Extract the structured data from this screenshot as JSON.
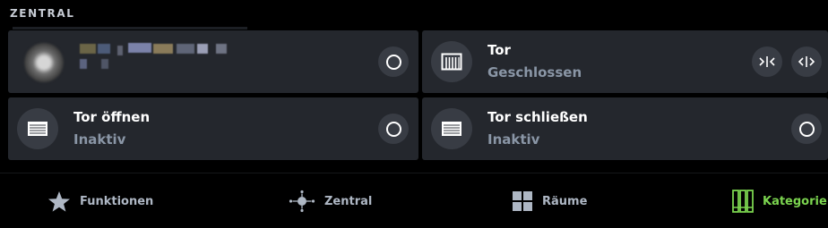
{
  "section": {
    "title": "ZENTRAL"
  },
  "cards": [
    {
      "title": "",
      "status": ""
    },
    {
      "title": "Tor",
      "status": "Geschlossen"
    },
    {
      "title": "Tor öffnen",
      "status": "Inaktiv"
    },
    {
      "title": "Tor schließen",
      "status": "Inaktiv"
    }
  ],
  "icons": {
    "toggle": "circle-toggle-icon",
    "gate": "garage-gate-icon",
    "close_gate": "arrows-inward-icon",
    "open_gate": "arrows-outward-icon",
    "blinds": "blinds-icon"
  },
  "nav": {
    "items": [
      {
        "label": "Funktionen",
        "icon": "star-icon"
      },
      {
        "label": "Zentral",
        "icon": "hub-icon"
      },
      {
        "label": "Räume",
        "icon": "grid-icon"
      },
      {
        "label": "Kategorie",
        "icon": "category-icon",
        "active": true
      }
    ]
  },
  "colors": {
    "accent": "#7bd44f",
    "card": "#24272d",
    "muted_text": "#8a96a6",
    "background": "#000000"
  }
}
